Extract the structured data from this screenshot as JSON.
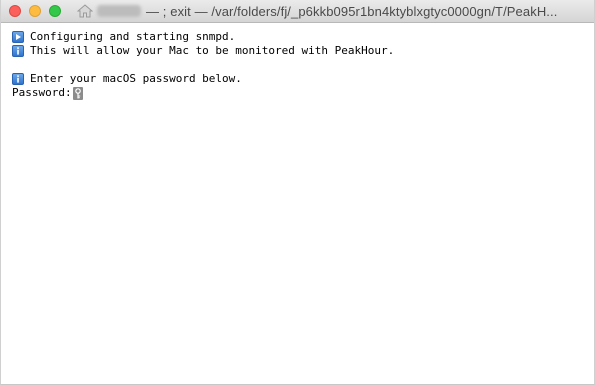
{
  "window": {
    "title_user": "",
    "title_text": "— ; exit — /var/folders/fj/_p6kkb095r1bn4ktyblxgtyc0000gn/T/PeakH..."
  },
  "terminal": {
    "lines": [
      {
        "icon": "play-icon",
        "text": "Configuring and starting snmpd."
      },
      {
        "icon": "info-icon",
        "text": "This will allow your Mac to be monitored with PeakHour."
      },
      {
        "icon": "",
        "text": ""
      },
      {
        "icon": "info-icon",
        "text": "Enter your macOS password below."
      }
    ],
    "prompt": "Password:"
  },
  "colors": {
    "close": "#fc605c",
    "minimize": "#fdbc40",
    "zoom": "#34c84a",
    "badge_blue": "#2f74cf"
  }
}
